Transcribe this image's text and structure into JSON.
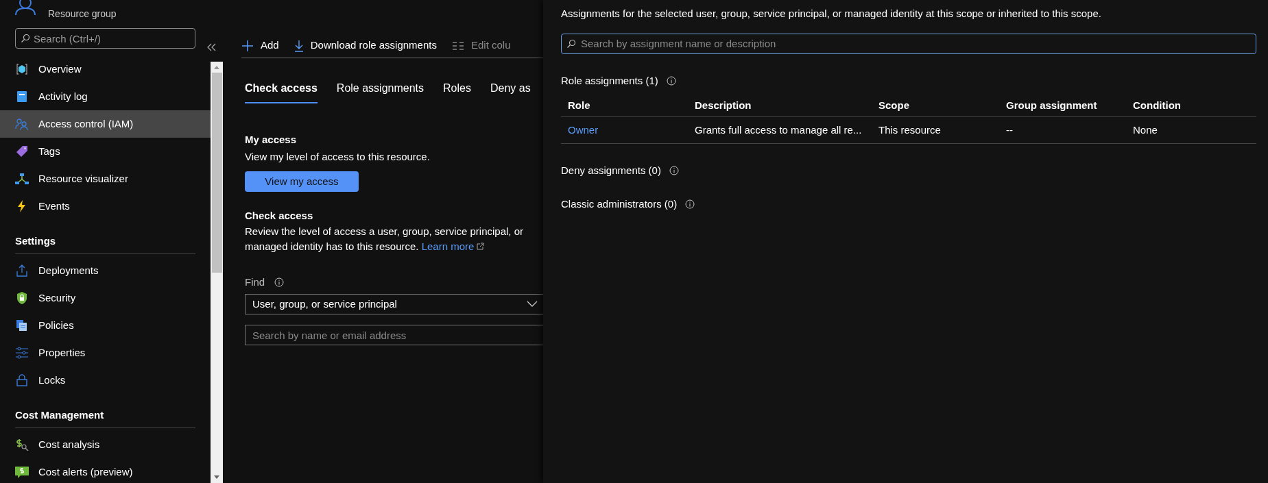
{
  "header": {
    "subtitle": "Resource group"
  },
  "sidebar": {
    "search_placeholder": "Search (Ctrl+/)",
    "sections": [
      {
        "items": [
          {
            "label": "Overview",
            "selected": false
          },
          {
            "label": "Activity log",
            "selected": false
          },
          {
            "label": "Access control (IAM)",
            "selected": true
          },
          {
            "label": "Tags",
            "selected": false
          },
          {
            "label": "Resource visualizer",
            "selected": false
          },
          {
            "label": "Events",
            "selected": false
          }
        ]
      },
      {
        "heading": "Settings",
        "items": [
          {
            "label": "Deployments",
            "selected": false
          },
          {
            "label": "Security",
            "selected": false
          },
          {
            "label": "Policies",
            "selected": false
          },
          {
            "label": "Properties",
            "selected": false
          },
          {
            "label": "Locks",
            "selected": false
          }
        ]
      },
      {
        "heading": "Cost Management",
        "items": [
          {
            "label": "Cost analysis",
            "selected": false
          },
          {
            "label": "Cost alerts (preview)",
            "selected": false
          }
        ]
      }
    ]
  },
  "toolbar": [
    {
      "label": "Add",
      "disabled": false
    },
    {
      "label": "Download role assignments",
      "disabled": false
    },
    {
      "label": "Edit colu",
      "disabled": true
    }
  ],
  "tabs": [
    {
      "label": "Check access",
      "selected": true
    },
    {
      "label": "Role assignments",
      "selected": false
    },
    {
      "label": "Roles",
      "selected": false
    },
    {
      "label": "Deny as",
      "selected": false
    }
  ],
  "my_access": {
    "heading": "My access",
    "text": "View my level of access to this resource.",
    "button": "View my access"
  },
  "check_access": {
    "heading": "Check access",
    "text": "Review the level of access a user, group, service principal, or managed identity has to this resource.",
    "link": "Learn more",
    "find_label": "Find",
    "find_value": "User, group, or service principal",
    "search_placeholder": "Search by name or email address"
  },
  "panel": {
    "description": "Assignments for the selected user, group, service principal, or managed identity at this scope or inherited to this scope.",
    "search_placeholder": "Search by assignment name or description",
    "role_assignments": {
      "title": "Role assignments (1)",
      "columns": [
        "Role",
        "Description",
        "Scope",
        "Group assignment",
        "Condition"
      ],
      "rows": [
        [
          "Owner",
          "Grants full access to manage all re...",
          "This resource",
          "--",
          "None"
        ]
      ]
    },
    "sections": [
      "Deny assignments (0)",
      "Classic administrators (0)"
    ]
  }
}
